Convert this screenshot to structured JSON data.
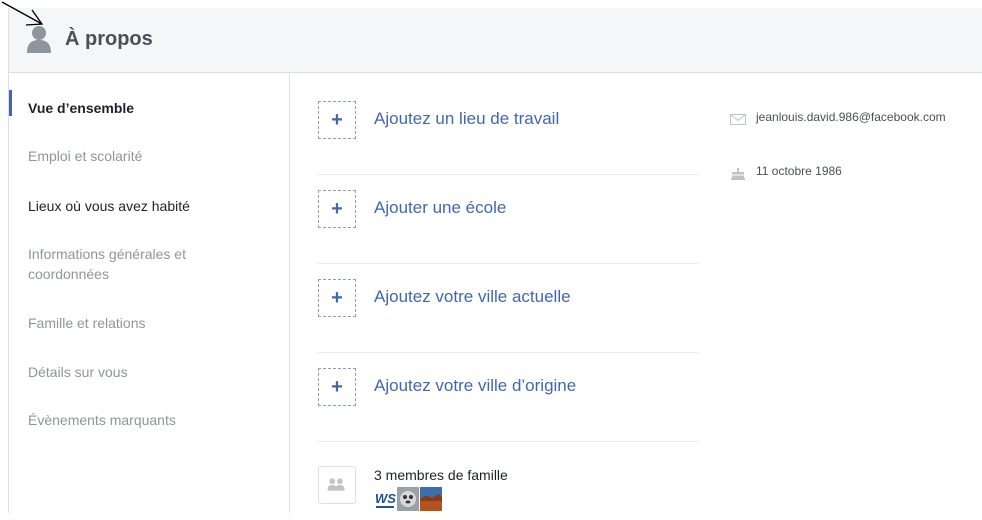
{
  "header": {
    "title": "À propos"
  },
  "sidebar": {
    "items": [
      {
        "label": "Vue d’ensemble"
      },
      {
        "label": "Emploi et scolarité"
      },
      {
        "label": "Lieux où vous avez habité"
      },
      {
        "label": "Informations générales et coordonnées"
      },
      {
        "label": "Famille et relations"
      },
      {
        "label": "Détails sur vous"
      },
      {
        "label": "Évènements marquants"
      }
    ]
  },
  "main": {
    "add_rows": [
      {
        "label": "Ajoutez un lieu de travail"
      },
      {
        "label": "Ajouter une école"
      },
      {
        "label": "Ajoutez votre ville actuelle"
      },
      {
        "label": "Ajoutez votre ville d’origine"
      }
    ],
    "family": {
      "label": "3 membres de famille",
      "thumb_logo_text": "WS"
    }
  },
  "contact": {
    "email": "jeanlouis.david.986@facebook.com",
    "birthday": "11 octobre 1986"
  },
  "colors": {
    "accent": "#4267b2",
    "muted": "#90949c",
    "header_bg": "#f5f6f7"
  },
  "icons": [
    "person-icon",
    "plus-icon",
    "mail-icon",
    "cake-icon",
    "family-icon",
    "cursor-arrow-icon"
  ]
}
